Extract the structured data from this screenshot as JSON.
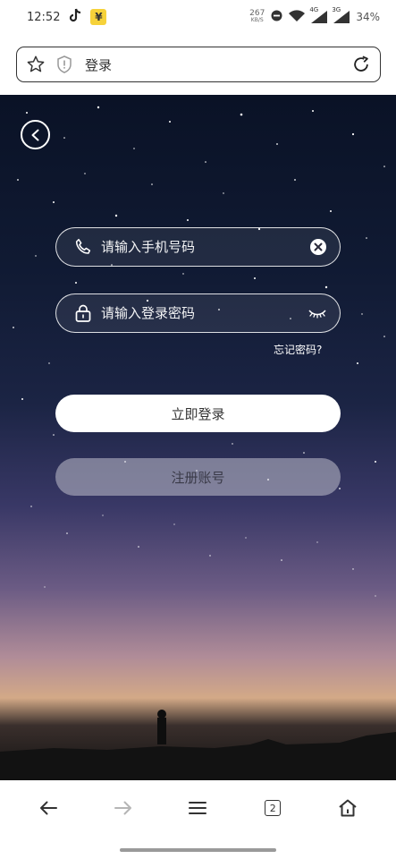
{
  "status_bar": {
    "time": "12:52",
    "tiktok_icon": "tiktok-icon",
    "money_icon": "yen-icon",
    "money_glyph": "¥",
    "net_speed_value": "267",
    "net_speed_unit": "KB/S",
    "net_4g": "4G",
    "net_3g": "3G",
    "battery": "34%"
  },
  "address_bar": {
    "title": "登录",
    "icons": [
      "star-icon",
      "shield-icon",
      "reload-icon"
    ]
  },
  "login": {
    "phone_placeholder": "请输入手机号码",
    "password_placeholder": "请输入登录密码",
    "forgot_password": "忘记密码?",
    "login_button": "立即登录",
    "register_button": "注册账号"
  },
  "bottom_nav": {
    "tab_count": "2",
    "icons": [
      "back-arrow-icon",
      "forward-arrow-icon",
      "menu-icon",
      "tabs-icon",
      "home-icon"
    ]
  },
  "colors": {
    "sky_top": "#0a1226",
    "horizon": "#d3a987",
    "button_primary": "#ffffff",
    "button_secondary": "#b4b4c3"
  }
}
